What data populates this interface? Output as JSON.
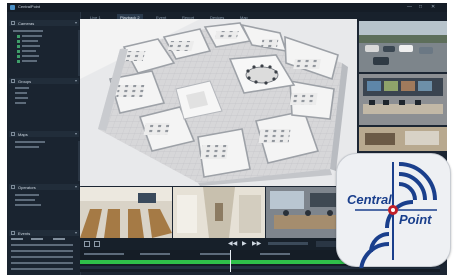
{
  "window": {
    "title": "CentralPoint"
  },
  "tabs": [
    {
      "label": "Live 1"
    },
    {
      "label": "Playback 2"
    },
    {
      "label": "Event"
    },
    {
      "label": "Report"
    },
    {
      "label": "Devices"
    },
    {
      "label": "Map"
    }
  ],
  "sidebar": {
    "panels": [
      {
        "title": "Cameras"
      },
      {
        "title": "Groups"
      },
      {
        "title": "Maps"
      },
      {
        "title": "Operators"
      },
      {
        "title": "Events"
      }
    ]
  },
  "logo": {
    "word1": "Central",
    "word2": "Point"
  },
  "colors": {
    "app_bg": "#1c2633",
    "accent": "#4a90c8",
    "timeline_green": "#2fbf4a",
    "logo_blue": "#1a3f8c",
    "logo_red": "#c0202a"
  }
}
